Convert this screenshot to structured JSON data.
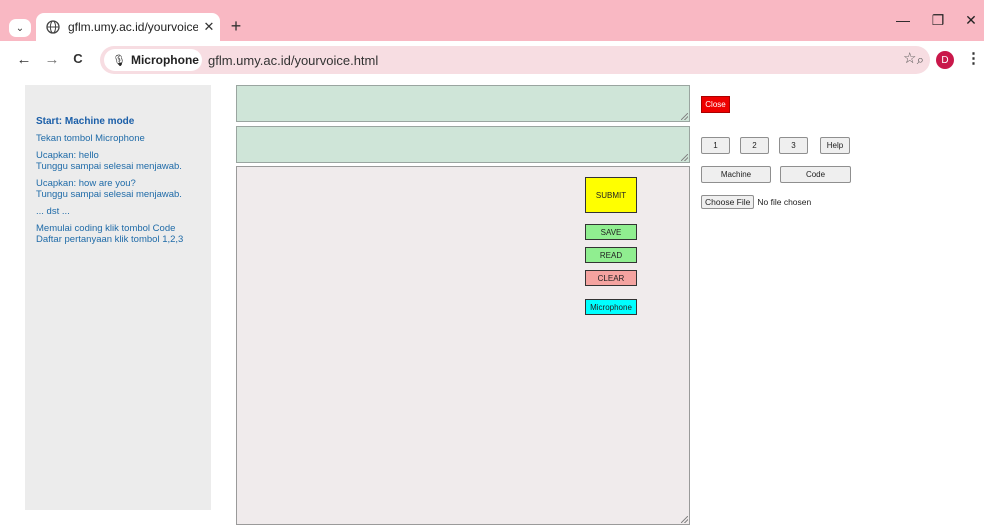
{
  "browser": {
    "tab_title": "gflm.umy.ac.id/yourvoice.html",
    "tab_close": "✕",
    "new_tab": "+",
    "minimize": "—",
    "restore": "❐",
    "close_window": "✕",
    "back": "←",
    "forward": "→",
    "reload": "C",
    "site_chip_label": "Microphone not",
    "url": "gflm.umy.ac.id/yourvoice.html",
    "profile_initial": "D",
    "profile_color": "#c9184a",
    "tab_bar_color": "#f9b8c3"
  },
  "sidebar": {
    "title": "Start: Machine mode",
    "lines": [
      "Tekan tombol Microphone",
      "Ucapkan: hello",
      "Tunggu sampai selesai menjawab.",
      "Ucapkan: how are you?",
      "Tunggu sampai selesai menjawab.",
      "... dst ...",
      "Memulai coding klik tombol Code",
      "Daftar pertanyaan klik tombol 1,2,3"
    ]
  },
  "buttons": {
    "submit": "SUBMIT",
    "save": "SAVE",
    "read": "READ",
    "clear": "CLEAR",
    "microphone": "Microphone",
    "close": "Close",
    "one": "1",
    "two": "2",
    "three": "3",
    "help": "Help",
    "machine": "Machine",
    "code": "Code"
  },
  "file_input": {
    "button_label": "Choose File",
    "status": "No file chosen"
  },
  "colors": {
    "submit": "#ffff00",
    "save": "#90ee90",
    "clear": "#f4a3a0",
    "microphone": "#00ffff",
    "close": "#ee0000",
    "textarea_green": "#cfe5d8",
    "textarea_main": "#f0ebec"
  }
}
